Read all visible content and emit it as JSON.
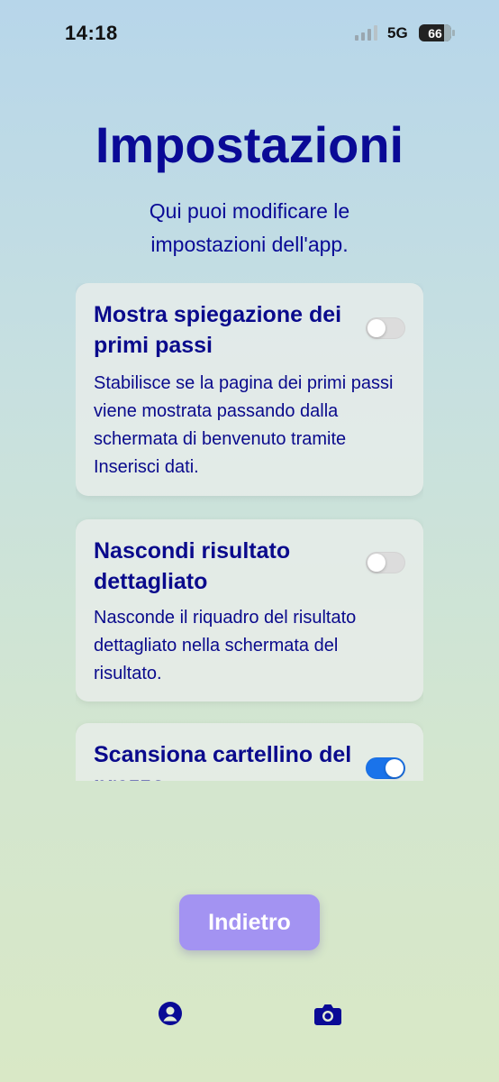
{
  "status_bar": {
    "time": "14:18",
    "network": "5G",
    "battery": "66"
  },
  "page": {
    "title": "Impostazioni",
    "subtitle": "Qui puoi modificare le impostazioni dell'app."
  },
  "settings": [
    {
      "title": "Mostra spiegazione dei primi passi",
      "description": "Stabilisce se la pagina dei primi passi viene mostrata passando dalla schermata di benvenuto tramite Inserisci dati.",
      "enabled": false
    },
    {
      "title": "Nascondi risultato dettagliato",
      "description": "Nasconde il riquadro del risultato dettagliato nella schermata del risultato.",
      "enabled": false
    },
    {
      "title": "Scansiona cartellino del prezzo",
      "description": "",
      "enabled": true
    }
  ],
  "actions": {
    "back_label": "Indietro"
  },
  "tab_bar": {
    "items": [
      {
        "icon": "profile-icon"
      },
      {
        "icon": "camera-icon"
      }
    ]
  },
  "colors": {
    "primary_text": "#0a0a96",
    "button": "#a393f2",
    "toggle_on": "#1a73ea",
    "toggle_off": "#dcdcdc"
  }
}
